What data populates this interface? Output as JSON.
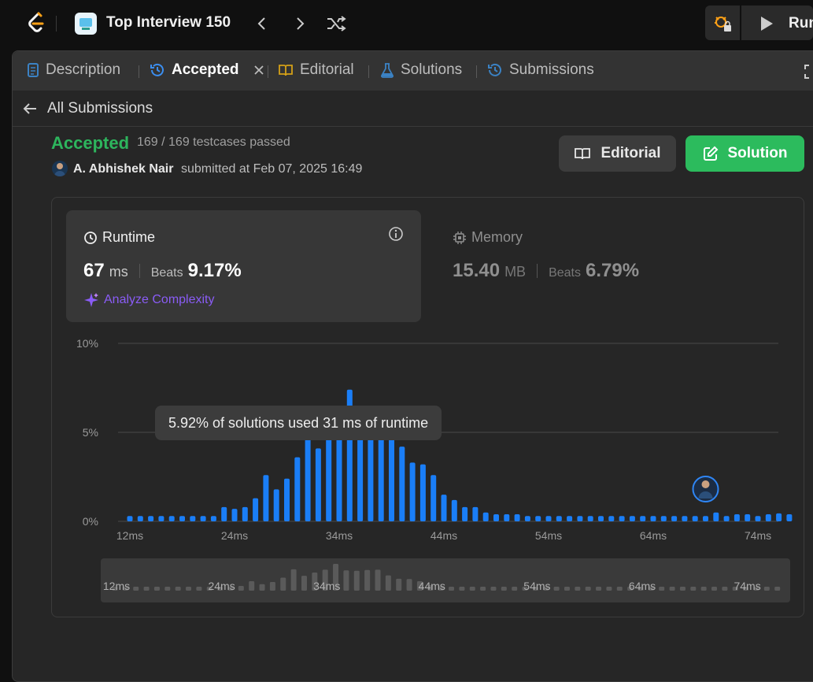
{
  "topbar": {
    "list_title": "Top Interview 150",
    "run_label": "Run"
  },
  "tabs": [
    {
      "label": "Description",
      "icon": "document-icon"
    },
    {
      "label": "Accepted",
      "icon": "history-icon"
    },
    {
      "label": "Editorial",
      "icon": "book-icon"
    },
    {
      "label": "Solutions",
      "icon": "flask-icon"
    },
    {
      "label": "Submissions",
      "icon": "history-icon"
    }
  ],
  "back_label": "All Submissions",
  "submission": {
    "status": "Accepted",
    "testcases": "169 / 169 testcases passed",
    "user": "A. Abhishek Nair",
    "submitted_at": "submitted at Feb 07, 2025 16:49"
  },
  "buttons": {
    "editorial": "Editorial",
    "solution": "Solution"
  },
  "runtime": {
    "title": "Runtime",
    "value": "67",
    "unit": "ms",
    "beats_label": "Beats",
    "beats_value": "9.17%",
    "analyze_label": "Analyze Complexity"
  },
  "memory": {
    "title": "Memory",
    "value": "15.40",
    "unit": "MB",
    "beats_label": "Beats",
    "beats_value": "6.79%"
  },
  "tooltip": "5.92% of solutions used 31 ms of runtime",
  "colors": {
    "accepted": "#2db55d",
    "bar": "#1a7ef7",
    "solution_button": "#2cbb5d",
    "analyze": "#8a5cf6"
  },
  "chart_data": {
    "type": "bar",
    "x": [
      12,
      13,
      14,
      15,
      16,
      17,
      18,
      19,
      20,
      21,
      22,
      23,
      24,
      25,
      26,
      27,
      28,
      29,
      30,
      31,
      32,
      33,
      34,
      35,
      36,
      37,
      38,
      39,
      40,
      41,
      42,
      43,
      44,
      45,
      46,
      47,
      48,
      49,
      50,
      51,
      52,
      53,
      54,
      55,
      56,
      57,
      58,
      59,
      60,
      61,
      62,
      63,
      64,
      65,
      66,
      67,
      68,
      69,
      70,
      71,
      72,
      73,
      74,
      75
    ],
    "values": [
      0.3,
      0.3,
      0.3,
      0.3,
      0.3,
      0.3,
      0.3,
      0.3,
      0.3,
      0.8,
      0.7,
      0.8,
      1.3,
      2.6,
      1.8,
      2.4,
      3.6,
      5.9,
      4.1,
      5.0,
      5.8,
      7.4,
      5.6,
      5.5,
      5.7,
      5.8,
      4.2,
      3.3,
      3.2,
      2.6,
      1.5,
      1.2,
      0.8,
      0.8,
      0.5,
      0.4,
      0.4,
      0.4,
      0.3,
      0.3,
      0.3,
      0.3,
      0.3,
      0.3,
      0.3,
      0.3,
      0.3,
      0.3,
      0.3,
      0.3,
      0.3,
      0.3,
      0.3,
      0.3,
      0.3,
      0.3,
      0.5,
      0.3,
      0.4,
      0.4,
      0.3,
      0.4,
      0.45,
      0.4
    ],
    "x_tick_labels": [
      "12ms",
      "24ms",
      "34ms",
      "44ms",
      "54ms",
      "64ms",
      "74ms"
    ],
    "x_tick_values": [
      12,
      22,
      32,
      42,
      52,
      62,
      72
    ],
    "y_tick_labels": [
      "0%",
      "5%",
      "10%"
    ],
    "y_tick_values": [
      0,
      5,
      10
    ],
    "ylim": [
      0,
      10
    ],
    "grid": true,
    "highlight_x": 67
  }
}
